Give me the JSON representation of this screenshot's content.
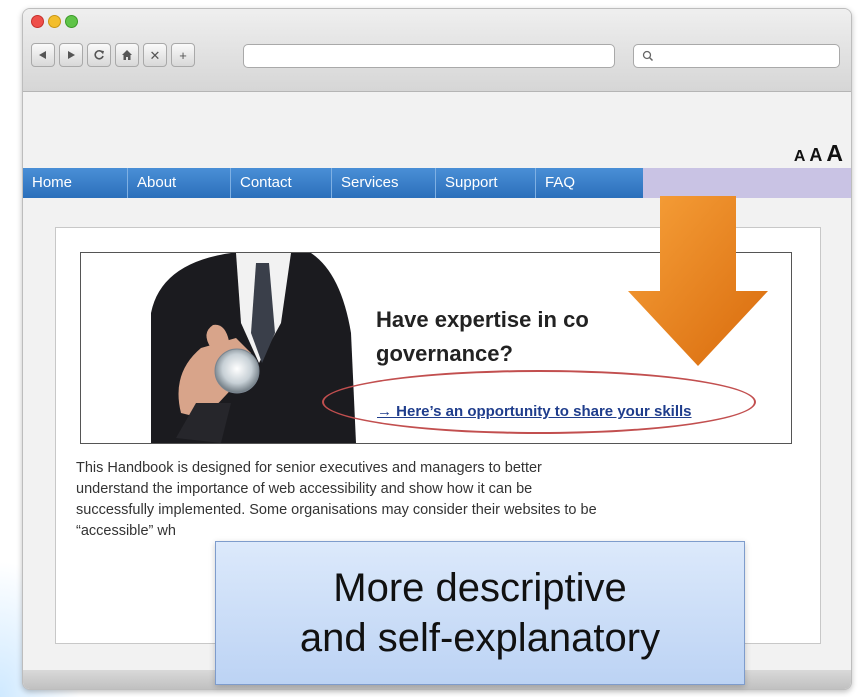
{
  "browser": {
    "toolbar_icons": [
      "back-icon",
      "forward-icon",
      "reload-icon",
      "home-icon",
      "close-icon",
      "new-tab-icon"
    ],
    "new_tab_label": "+",
    "close_label": "✕"
  },
  "header": {
    "font_size_controls": [
      "A",
      "A",
      "A"
    ]
  },
  "nav": {
    "items": [
      "Home",
      "About",
      "Contact",
      "Services",
      "Support",
      "FAQ"
    ],
    "color": "#2b6fbb"
  },
  "banner": {
    "heading_line1": "Have expertise in co",
    "heading_line2": "governance?",
    "link_text": "→ Here’s an opportunity to share your skills"
  },
  "paragraph": {
    "lines": [
      "This Handbook is designed for senior executives and managers to better",
      "understand the importance of web accessibility and show how it can be",
      "successfully implemented. Some organisations may consider their websites to be",
      "“accessible” wh"
    ]
  },
  "annotation": {
    "callout_line1": "More descriptive",
    "callout_line2": "and self-explanatory",
    "highlight_color": "#c24f4f",
    "arrow_color": "#f08a1e"
  }
}
